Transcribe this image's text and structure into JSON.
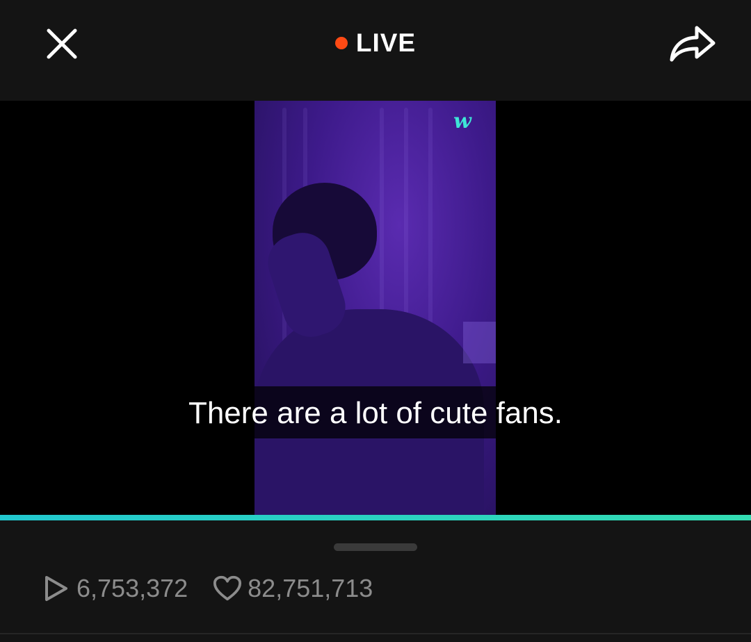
{
  "header": {
    "live_label": "LIVE",
    "live_dot_color": "#ff4a14",
    "close_icon": "close-icon",
    "share_icon": "share-icon"
  },
  "video": {
    "watermark": "w",
    "subtitle": "There are a lot of cute fans.",
    "progress_fraction": 1.0,
    "accent_color": "#22c8cf"
  },
  "stats": {
    "views": "6,753,372",
    "views_icon": "play-icon",
    "likes": "82,751,713",
    "likes_icon": "heart-icon"
  }
}
